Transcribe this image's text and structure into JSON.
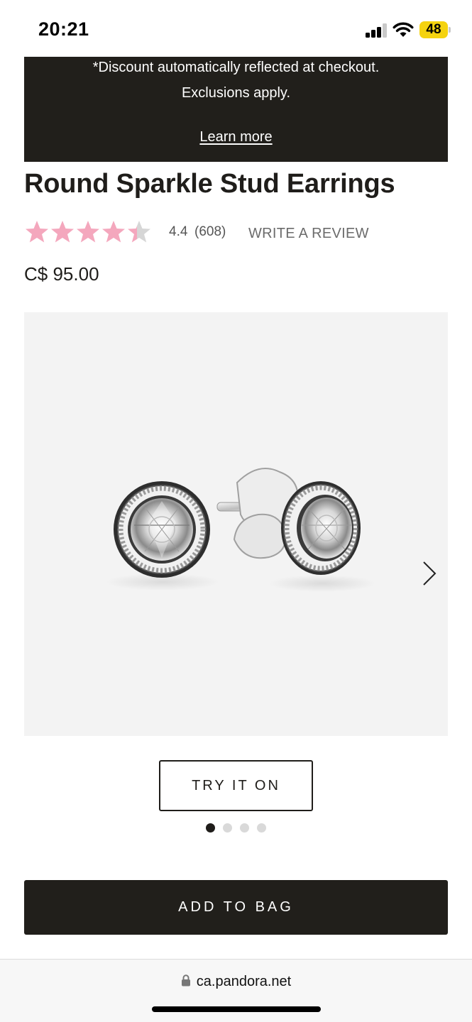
{
  "status_bar": {
    "time": "20:21",
    "battery": "48",
    "icons": [
      "signal-icon",
      "wifi-icon",
      "battery-icon"
    ]
  },
  "promo": {
    "line1": "*Discount automatically reflected at checkout.",
    "line2": "Exclusions apply.",
    "link": "Learn more"
  },
  "product": {
    "title": "Round Sparkle Stud Earrings",
    "rating": "4.4",
    "rating_value": 4.4,
    "rating_max": 5,
    "review_count": "(608)",
    "write_review": "WRITE A REVIEW",
    "price": "C$ 95.00",
    "image_icon": "earrings-image",
    "gallery_count": 4,
    "gallery_active": 0
  },
  "actions": {
    "try_on": "TRY IT ON",
    "add_to_bag": "ADD TO BAG"
  },
  "browser": {
    "url": "ca.pandora.net"
  },
  "colors": {
    "dark": "#211f1b",
    "star": "#f4a7bd",
    "star_empty": "#d6d6d6",
    "image_bg": "#f3f3f3"
  }
}
